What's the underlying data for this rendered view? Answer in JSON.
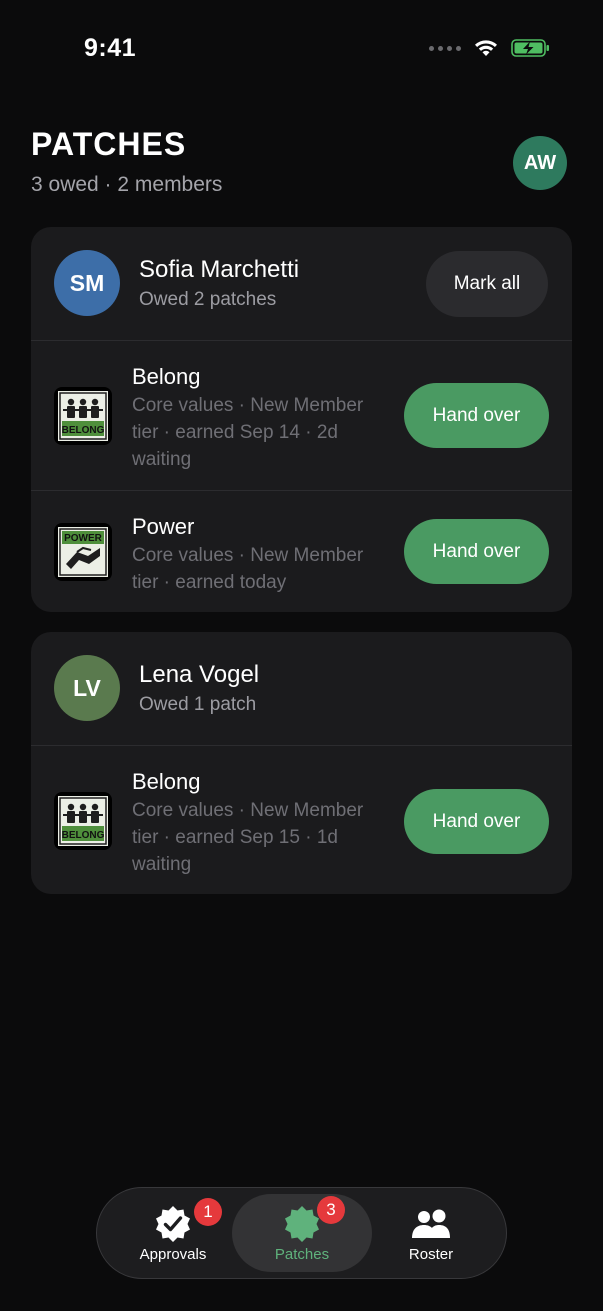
{
  "status_bar": {
    "time": "9:41"
  },
  "header": {
    "title": "PATCHES",
    "subtitle": "3 owed · 2 members",
    "user_initials": "AW"
  },
  "colors": {
    "accent_green": "#4a9a62",
    "badge_red": "#e5393c",
    "avatar_sm": "#3d6ea8",
    "avatar_lv": "#5a7a4e",
    "avatar_me": "#2e7a5e"
  },
  "members": [
    {
      "initials": "SM",
      "name": "Sofia Marchetti",
      "owed": "Owed 2 patches",
      "mark_all_label": "Mark all",
      "patches": [
        {
          "name": "Belong",
          "icon": "belong-patch-icon",
          "icon_text": "BELONG",
          "detail": "Core values · New Member tier · earned Sep 14 · 2d waiting",
          "action": "Hand over"
        },
        {
          "name": "Power",
          "icon": "power-patch-icon",
          "icon_text": "POWER",
          "detail": "Core values · New Member tier · earned today",
          "action": "Hand over"
        }
      ]
    },
    {
      "initials": "LV",
      "name": "Lena Vogel",
      "owed": "Owed 1 patch",
      "patches": [
        {
          "name": "Belong",
          "icon": "belong-patch-icon",
          "icon_text": "BELONG",
          "detail": "Core values · New Member tier · earned Sep 15 · 1d waiting",
          "action": "Hand over"
        }
      ]
    }
  ],
  "tabbar": {
    "tabs": [
      {
        "label": "Approvals",
        "icon": "approvals-check-badge-icon",
        "badge": "1",
        "active": false
      },
      {
        "label": "Patches",
        "icon": "patch-badge-icon",
        "badge": "3",
        "active": true
      },
      {
        "label": "Roster",
        "icon": "people-icon",
        "active": false
      }
    ]
  }
}
